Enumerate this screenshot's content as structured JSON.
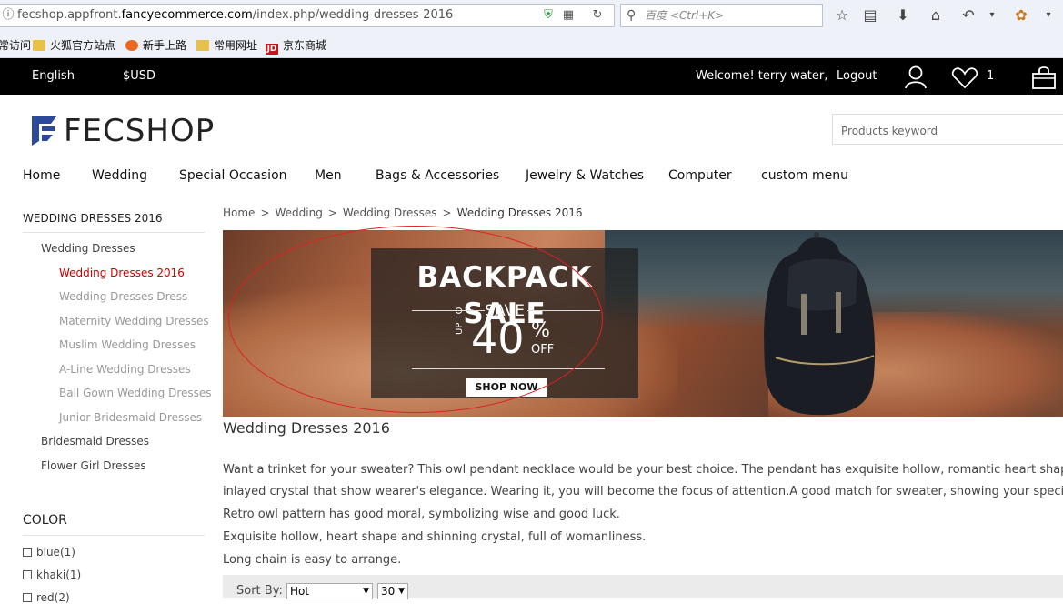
{
  "browser": {
    "url_prefix": "fecshop.appfront.",
    "url_host": "fancyecommerce.com",
    "url_path": "/index.php/wedding-dresses-2016",
    "search_placeholder": "百度 <Ctrl+K>"
  },
  "bookmarks": [
    {
      "label": "常访问"
    },
    {
      "label": "火狐官方站点"
    },
    {
      "label": "新手上路"
    },
    {
      "label": "常用网址"
    },
    {
      "label": "京东商城"
    }
  ],
  "topbar": {
    "language": "English",
    "currency": "$USD",
    "welcome": "Welcome! terry water,",
    "logout": "Logout",
    "wishlist_count": "1"
  },
  "header": {
    "logo_text": "FECSHOP",
    "search_placeholder": "Products keyword"
  },
  "nav": [
    "Home",
    "Wedding",
    "Special Occasion",
    "Men",
    "Bags & Accessories",
    "Jewelry & Watches",
    "Computer",
    "custom menu"
  ],
  "sidebar": {
    "title": "WEDDING DRESSES 2016",
    "categories": [
      {
        "label": "Wedding Dresses",
        "level": 1
      },
      {
        "label": "Wedding Dresses 2016",
        "level": 2,
        "active": true
      },
      {
        "label": "Wedding Dresses Dress",
        "level": 2
      },
      {
        "label": "Maternity Wedding Dresses",
        "level": 2
      },
      {
        "label": "Muslim Wedding Dresses",
        "level": 2
      },
      {
        "label": "A-Line Wedding Dresses",
        "level": 2
      },
      {
        "label": "Ball Gown Wedding Dresses",
        "level": 2
      },
      {
        "label": "Junior Bridesmaid Dresses",
        "level": 2
      },
      {
        "label": "Bridesmaid Dresses",
        "level": 1
      },
      {
        "label": "Flower Girl Dresses",
        "level": 1
      }
    ],
    "color_title": "COLOR",
    "colors": [
      "blue(1)",
      "khaki(1)",
      "red(2)"
    ]
  },
  "breadcrumb": [
    "Home",
    "Wedding",
    "Wedding Dresses",
    "Wedding Dresses 2016"
  ],
  "banner": {
    "title": "BACKPACK SALE",
    "save": "SAVE",
    "upto": "UP TO",
    "percent": "40",
    "percent_sign": "%",
    "off": "OFF",
    "button": "SHOP NOW"
  },
  "page_heading": "Wedding Dresses 2016",
  "description": [
    "Want a trinket for your sweater? This owl pendant necklace would be your best choice. The pendant has exquisite hollow, romantic heart shape and",
    "inlayed crystal that show wearer's elegance. Wearing it, you will become the focus of attention.A good match for sweater, showing your special taste.",
    "Retro owl pattern has good moral, symbolizing wise and good luck.",
    "Exquisite hollow, heart shape and shinning crystal, full of womanliness.",
    "Long chain is easy to arrange."
  ],
  "sort": {
    "label": "Sort By:",
    "sort_value": "Hot",
    "per_page": "30"
  },
  "colors_theme": {
    "accent": "#cc0000",
    "topbar": "#000000",
    "logo_blue": "#2b4a9a"
  }
}
